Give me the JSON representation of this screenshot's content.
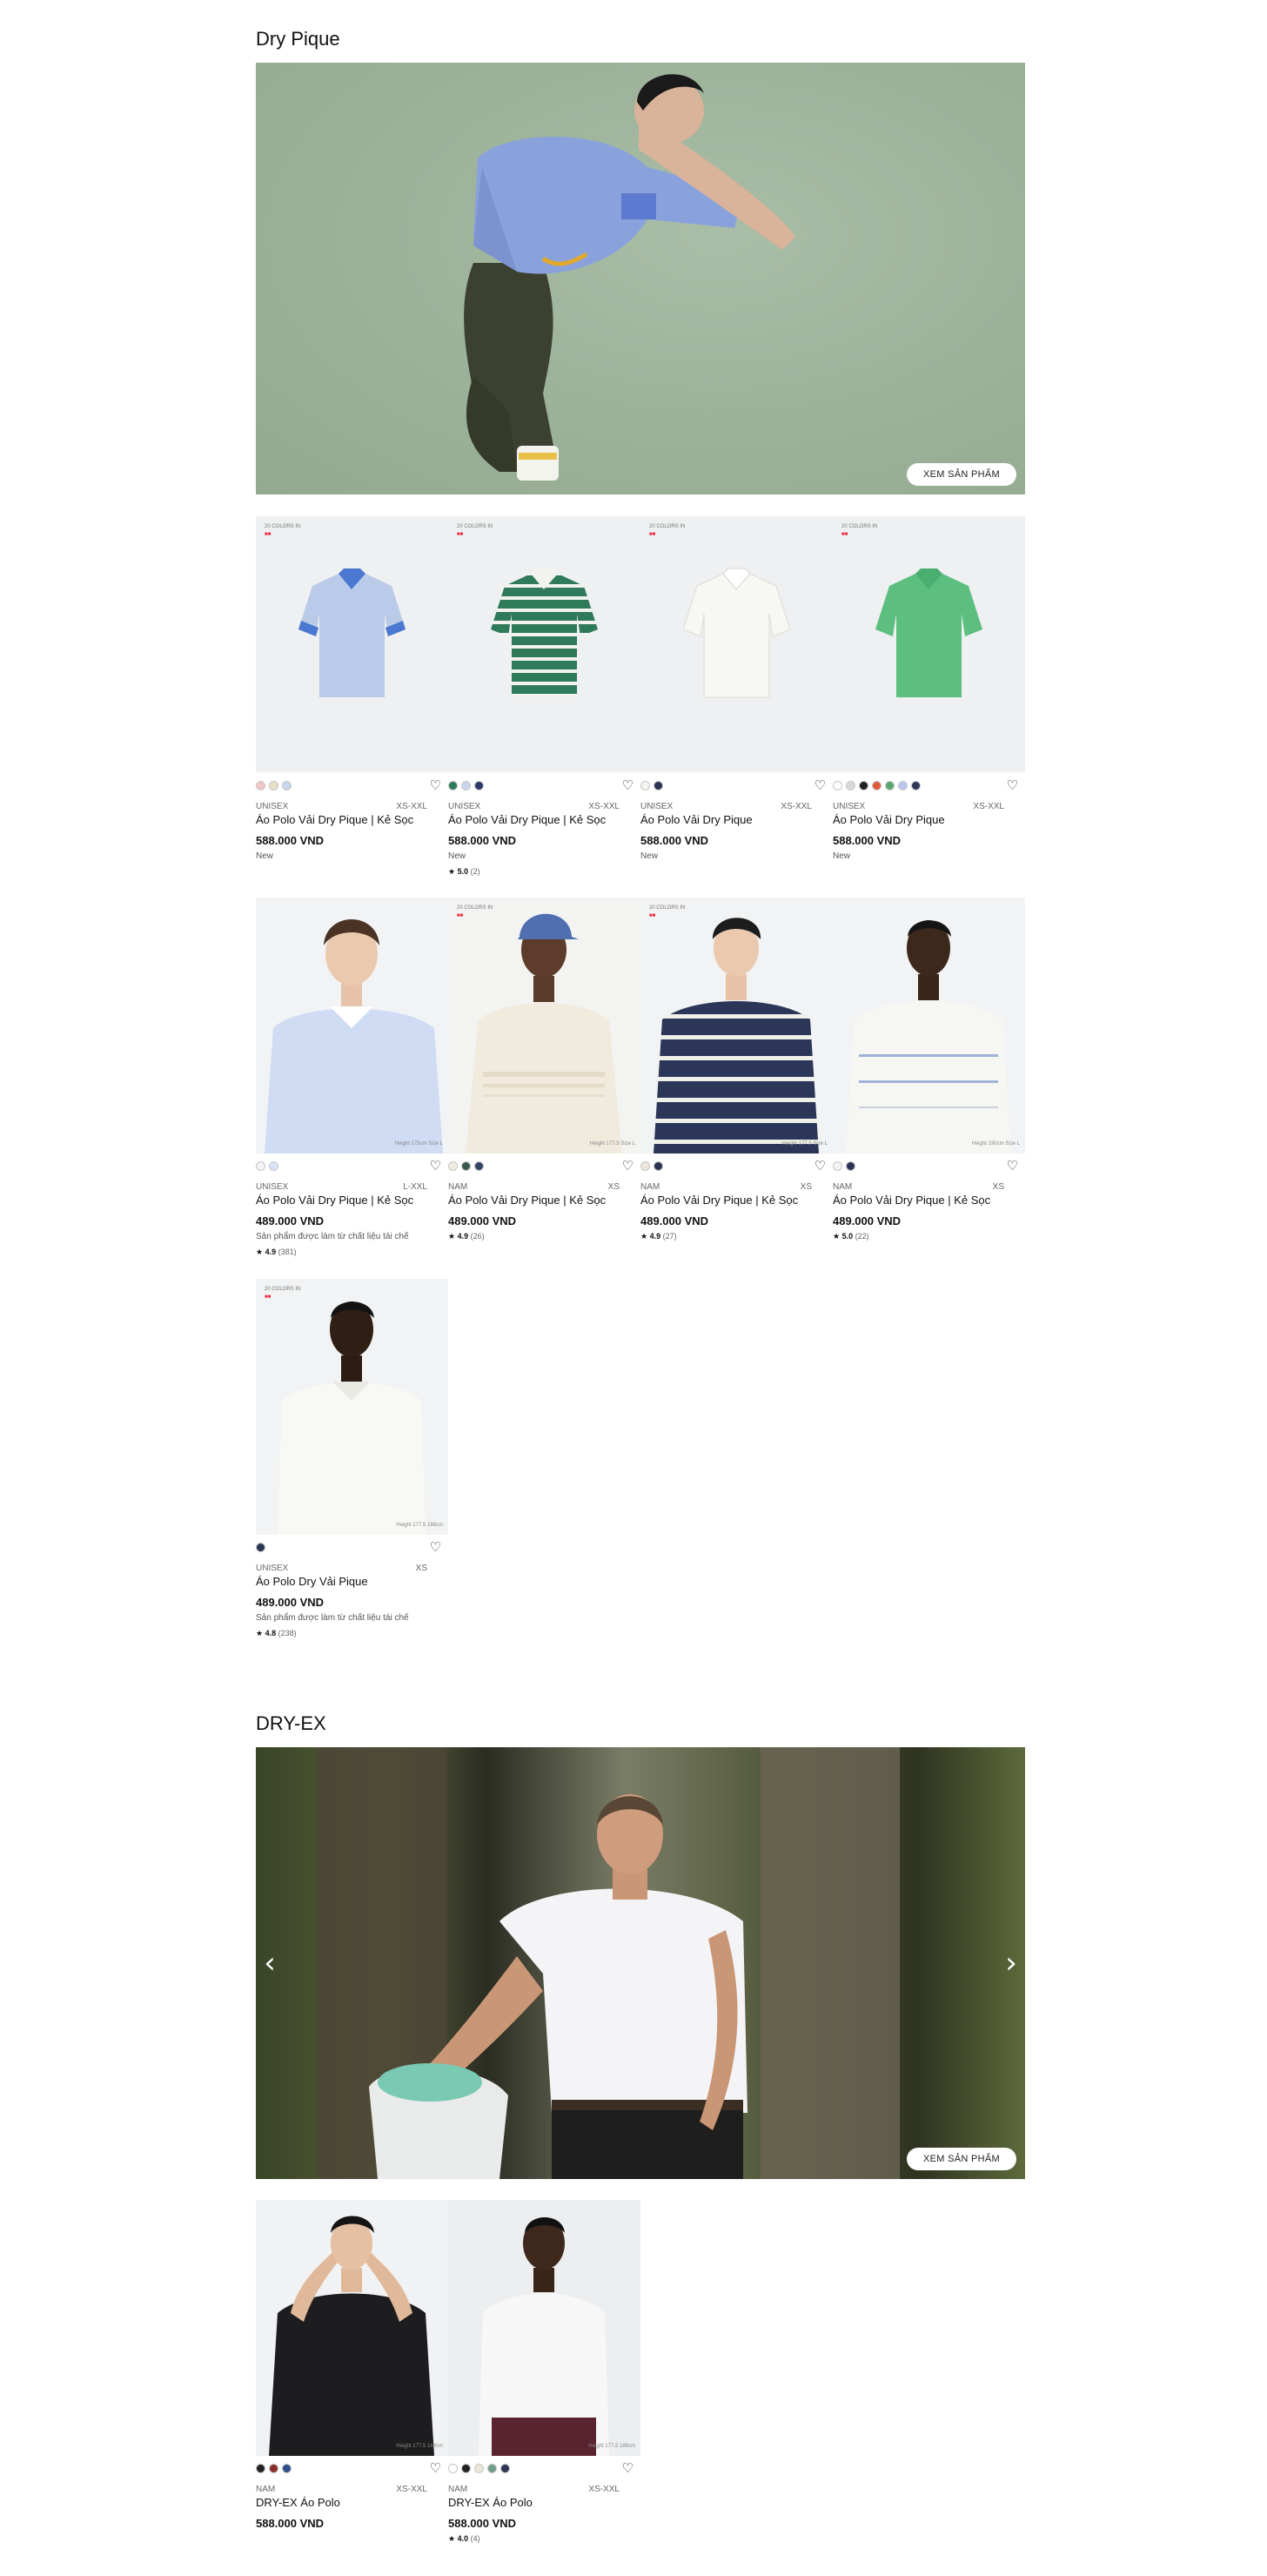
{
  "sections": [
    {
      "title": "Dry Pique",
      "hero_button": "XEM SẢN PHẨM",
      "products": [
        {
          "badge_line": "20 COLORS IN",
          "badge_mark": "■■",
          "swatches": [
            "#f3c6c6",
            "#e9e0c8",
            "#c7d6ea"
          ],
          "gender": "UNISEX",
          "size": "XS-XXL",
          "name": "Áo Polo Vải Dry Pique | Kẻ Sọc",
          "price": "588.000 VND",
          "note": "New",
          "rating": "",
          "reviews": ""
        },
        {
          "badge_line": "20 COLORS IN",
          "badge_mark": "■■",
          "swatches": [
            "#2e7a5a",
            "#c9d6ee",
            "#2d3a66"
          ],
          "gender": "UNISEX",
          "size": "XS-XXL",
          "name": "Áo Polo Vải Dry Pique | Kẻ Sọc",
          "price": "588.000 VND",
          "note": "New",
          "rating": "5.0",
          "reviews": "(2)"
        },
        {
          "badge_line": "20 COLORS IN",
          "badge_mark": "■■",
          "swatches": [
            "#f4f4f1",
            "#2a3553"
          ],
          "gender": "UNISEX",
          "size": "XS-XXL",
          "name": "Áo Polo Vải Dry Pique",
          "price": "588.000 VND",
          "note": "New",
          "rating": "",
          "reviews": ""
        },
        {
          "badge_line": "20 COLORS IN",
          "badge_mark": "■■",
          "swatches": [
            "#ffffff",
            "#d9d9d9",
            "#222222",
            "#e05a3a",
            "#5aa86f",
            "#b8c6ee",
            "#2d3556"
          ],
          "gender": "UNISEX",
          "size": "XS-XXL",
          "name": "Áo Polo Vải Dry Pique",
          "price": "588.000 VND",
          "note": "New",
          "rating": "",
          "reviews": ""
        },
        {
          "badge_line": "",
          "badge_mark": "",
          "swatches": [
            "#f3f3f3",
            "#d9e3f6"
          ],
          "gender": "UNISEX",
          "size": "L-XXL",
          "name": "Áo Polo Vải Dry Pique | Kẻ Sọc",
          "price": "489.000 VND",
          "note": "Sản phẩm được làm từ chất liệu tái chế",
          "rating": "4.9",
          "reviews": "(381)",
          "height_note": "Height 175cm Size L"
        },
        {
          "badge_line": "20 COLORS IN",
          "badge_mark": "■■",
          "swatches": [
            "#f1ece0",
            "#3b5a4f",
            "#34466a"
          ],
          "gender": "NAM",
          "size": "XS",
          "name": "Áo Polo Vải Dry Pique | Kẻ Sọc",
          "price": "489.000 VND",
          "note": "",
          "rating": "4.9",
          "reviews": "(26)",
          "height_note": "Height 177.5 Size L"
        },
        {
          "badge_line": "20 COLORS IN",
          "badge_mark": "■■",
          "swatches": [
            "#ede6d8",
            "#2a3553"
          ],
          "gender": "NAM",
          "size": "XS",
          "name": "Áo Polo Vải Dry Pique | Kẻ Sọc",
          "price": "489.000 VND",
          "note": "",
          "rating": "4.9",
          "reviews": "(27)",
          "height_note": "Height 177.5 Size L"
        },
        {
          "badge_line": "",
          "badge_mark": "",
          "swatches": [
            "#f3f3f3",
            "#2a3553"
          ],
          "gender": "NAM",
          "size": "XS",
          "name": "Áo Polo Vải Dry Pique | Kẻ Sọc",
          "price": "489.000 VND",
          "note": "",
          "rating": "5.0",
          "reviews": "(22)",
          "height_note": "Height 190cm Size L"
        },
        {
          "badge_line": "20 COLORS IN",
          "badge_mark": "■■",
          "swatches": [
            "#2a3553"
          ],
          "gender": "UNISEX",
          "size": "XS",
          "name": "Áo Polo Dry Vải Pique",
          "price": "489.000 VND",
          "note": "Sản phẩm được làm từ chất liệu tái chế",
          "rating": "4.8",
          "reviews": "(238)",
          "height_note": "Height 177.5 188cm"
        }
      ]
    },
    {
      "title": "DRY-EX",
      "hero_button": "XEM SẢN PHẨM",
      "prev_arrow": "‹",
      "next_arrow": "›",
      "products": [
        {
          "badge_line": "",
          "badge_mark": "",
          "swatches": [
            "#222222",
            "#8a2c2c",
            "#2d4f8a"
          ],
          "gender": "NAM",
          "size": "XS-XXL",
          "name": "DRY-EX Áo Polo",
          "price": "588.000 VND",
          "note": "",
          "rating": "",
          "reviews": "",
          "height_note": "Height 177.5 188cm"
        },
        {
          "badge_line": "",
          "badge_mark": "",
          "swatches": [
            "#ffffff",
            "#222222",
            "#e9e6d6",
            "#6e9e8a",
            "#2d3556"
          ],
          "gender": "NAM",
          "size": "XS-XXL",
          "name": "DRY-EX Áo Polo",
          "price": "588.000 VND",
          "note": "",
          "rating": "4.0",
          "reviews": "(4)",
          "height_note": "Height 177.5 188cm"
        }
      ]
    }
  ],
  "icons": {
    "heart": "heart-icon",
    "star": "star-icon",
    "chevron_left": "chevron-left-icon",
    "chevron_right": "chevron-right-icon"
  },
  "star_glyph": "★",
  "heart_glyph": "♡"
}
